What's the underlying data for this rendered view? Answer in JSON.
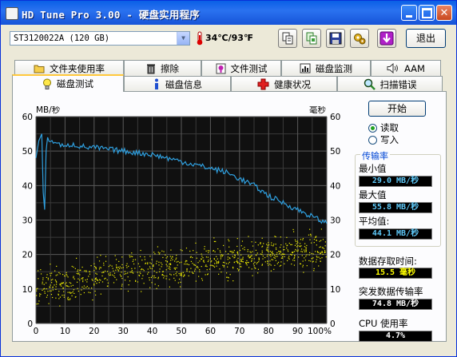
{
  "window": {
    "title": "HD Tune Pro 3.00 - 硬盘实用程序"
  },
  "toolbar": {
    "drive": "ST3120022A (120 GB)",
    "temperature": "34℃/93℉",
    "exit_label": "退出"
  },
  "tabs_back": [
    "文件夹使用率",
    "擦除",
    "文件测试",
    "磁盘监测",
    "AAM"
  ],
  "tabs_front": [
    "磁盘测试",
    "磁盘信息",
    "健康状况",
    "扫描错误"
  ],
  "controls": {
    "start_label": "开始",
    "read_label": "读取",
    "write_label": "写入",
    "mode_selected": "read"
  },
  "stats": {
    "group_title": "传输率",
    "min_label": "最小值",
    "min_value": "29.0 MB/秒",
    "max_label": "最大值",
    "max_value": "55.8 MB/秒",
    "avg_label": "平均值:",
    "avg_value": "44.1 MB/秒",
    "access_label": "数据存取时间:",
    "access_value": "15.5 毫秒",
    "burst_label": "突发数据传输率",
    "burst_value": "74.8 MB/秒",
    "cpu_label": "CPU 使用率",
    "cpu_value": "4.7%"
  },
  "chart_data": {
    "type": "line",
    "ylabel_left": "MB/秒",
    "ylabel_right": "毫秒",
    "ylim": [
      0,
      60
    ],
    "yticks": [
      "0",
      "10",
      "20",
      "30",
      "40",
      "50",
      "60"
    ],
    "xticks": [
      "0",
      "10",
      "20",
      "30",
      "40",
      "50",
      "60",
      "70",
      "80",
      "90",
      "100%"
    ],
    "grid": true,
    "transfer_color": "#2FA0E0",
    "access_color": "#F0F000",
    "series": [
      {
        "kind": "transfer",
        "x": [
          0,
          1,
          2,
          2.5,
          3,
          3.5,
          4,
          5,
          6,
          8,
          10,
          12,
          15,
          18,
          20,
          25,
          30,
          35,
          40,
          45,
          50,
          55,
          60,
          65,
          70,
          75,
          80,
          85,
          90,
          95,
          100
        ],
        "y": [
          48,
          53,
          55,
          38,
          33,
          50,
          54,
          52,
          53,
          52,
          51,
          52,
          51.5,
          51,
          51,
          50.5,
          50,
          49.5,
          49,
          48,
          47,
          46,
          45,
          44,
          42,
          40,
          37,
          35,
          33,
          31,
          29
        ]
      },
      {
        "kind": "access",
        "trend_x": [
          0,
          10,
          20,
          30,
          40,
          50,
          60,
          70,
          80,
          90,
          100
        ],
        "trend_y": [
          10.5,
          12,
          13.5,
          15,
          16,
          17,
          18,
          19,
          20,
          21,
          22
        ],
        "spread": 5
      }
    ]
  }
}
